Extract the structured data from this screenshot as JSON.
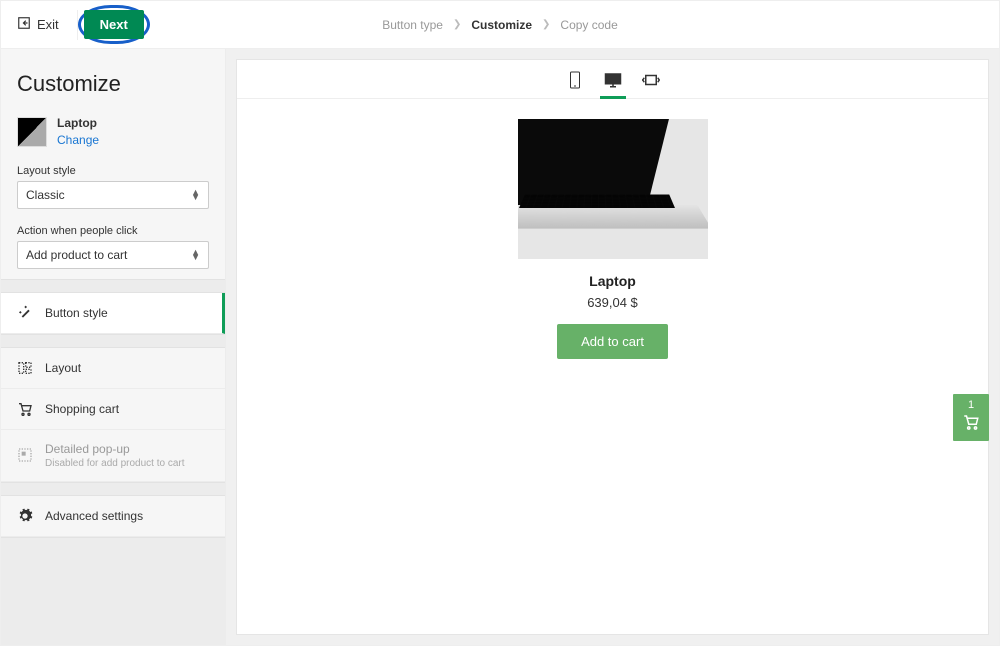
{
  "header": {
    "exit_label": "Exit",
    "breadcrumb": [
      "Button type",
      "Customize",
      "Copy code"
    ],
    "active_crumb_index": 1,
    "next_label": "Next"
  },
  "sidebar": {
    "title": "Customize",
    "product": {
      "name": "Laptop",
      "change_label": "Change"
    },
    "layout_style": {
      "label": "Layout style",
      "value": "Classic"
    },
    "click_action": {
      "label": "Action when people click",
      "value": "Add product to cart"
    },
    "sections": {
      "button_style": "Button style",
      "layout": "Layout",
      "shopping_cart": "Shopping cart",
      "detailed_popup": {
        "title": "Detailed pop-up",
        "sub": "Disabled for add product to cart"
      },
      "advanced": "Advanced settings"
    }
  },
  "preview": {
    "title": "Laptop",
    "price": "639,04 $",
    "add_label": "Add to cart"
  },
  "cart_fab": {
    "count": "1"
  }
}
